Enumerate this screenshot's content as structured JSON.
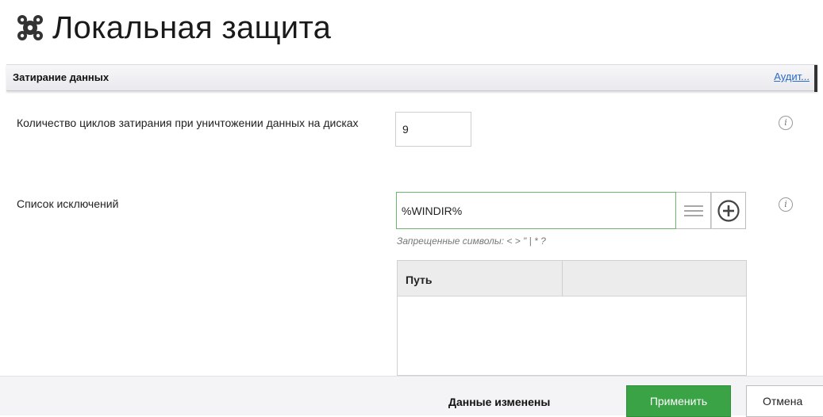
{
  "page": {
    "title": "Локальная защита",
    "icon": "shield-cogs-icon"
  },
  "section": {
    "title": "Затирание данных",
    "audit_link": "Аудит..."
  },
  "cycles": {
    "label": "Количество циклов затирания при уничтожении данных на дисках",
    "value": "9"
  },
  "exclusions": {
    "label": "Список исключений",
    "input_value": "%WINDIR%",
    "forbidden_hint": "Запрещенные символы: < > \" | * ?",
    "table_columns": [
      "Путь",
      ""
    ],
    "rows": []
  },
  "footer": {
    "status": "Данные изменены",
    "apply_label": "Применить",
    "cancel_label": "Отмена"
  },
  "colors": {
    "accent": "#3aa345",
    "link": "#2b6cc4",
    "input_focus_border": "#6db46d"
  }
}
